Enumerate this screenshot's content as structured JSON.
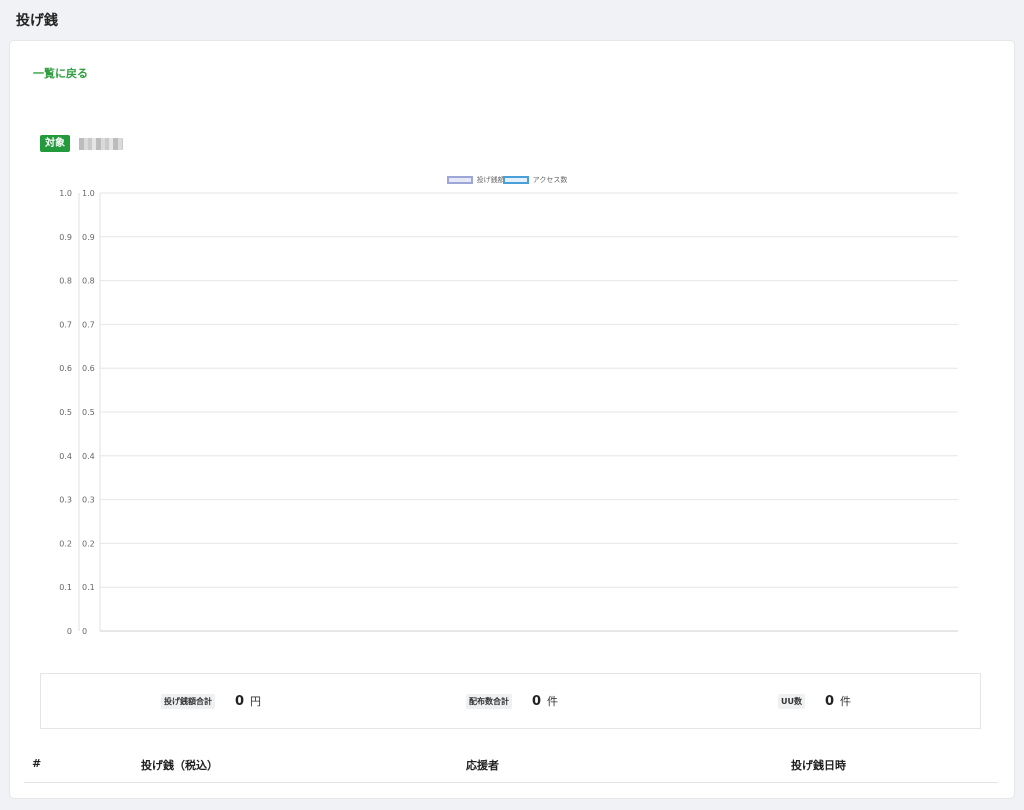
{
  "page": {
    "title": "投げ銭"
  },
  "back_link": {
    "label": "一覧に戻る"
  },
  "target": {
    "badge": "対象",
    "value": ""
  },
  "legend": [
    {
      "label": "投げ銭額",
      "color": "#9ea6d8"
    },
    {
      "label": "アクセス数",
      "color": "#4a9fd8"
    }
  ],
  "chart_data": {
    "type": "line",
    "series": [
      {
        "name": "投げ銭額",
        "values": []
      },
      {
        "name": "アクセス数",
        "values": []
      }
    ],
    "categories": [],
    "y_left": {
      "ticks": [
        "1.0",
        "0.9",
        "0.8",
        "0.7",
        "0.6",
        "0.5",
        "0.4",
        "0.3",
        "0.2",
        "0.1",
        "0"
      ],
      "ylim": [
        0,
        1
      ]
    },
    "y_right": {
      "ticks": [
        "1.0",
        "0.9",
        "0.8",
        "0.7",
        "0.6",
        "0.5",
        "0.4",
        "0.3",
        "0.2",
        "0.1",
        "0"
      ],
      "ylim": [
        0,
        1
      ]
    },
    "grid": true,
    "legend_position": "top-center"
  },
  "summary": {
    "tip_total": {
      "label": "投げ銭額合計",
      "value": "0",
      "unit": "円"
    },
    "distribution_total": {
      "label": "配布数合計",
      "value": "0",
      "unit": "件"
    },
    "uu": {
      "label": "UU数",
      "value": "0",
      "unit": "件"
    }
  },
  "table": {
    "headers": [
      "#",
      "投げ銭（税込）",
      "応援者",
      "投げ銭日時"
    ]
  }
}
